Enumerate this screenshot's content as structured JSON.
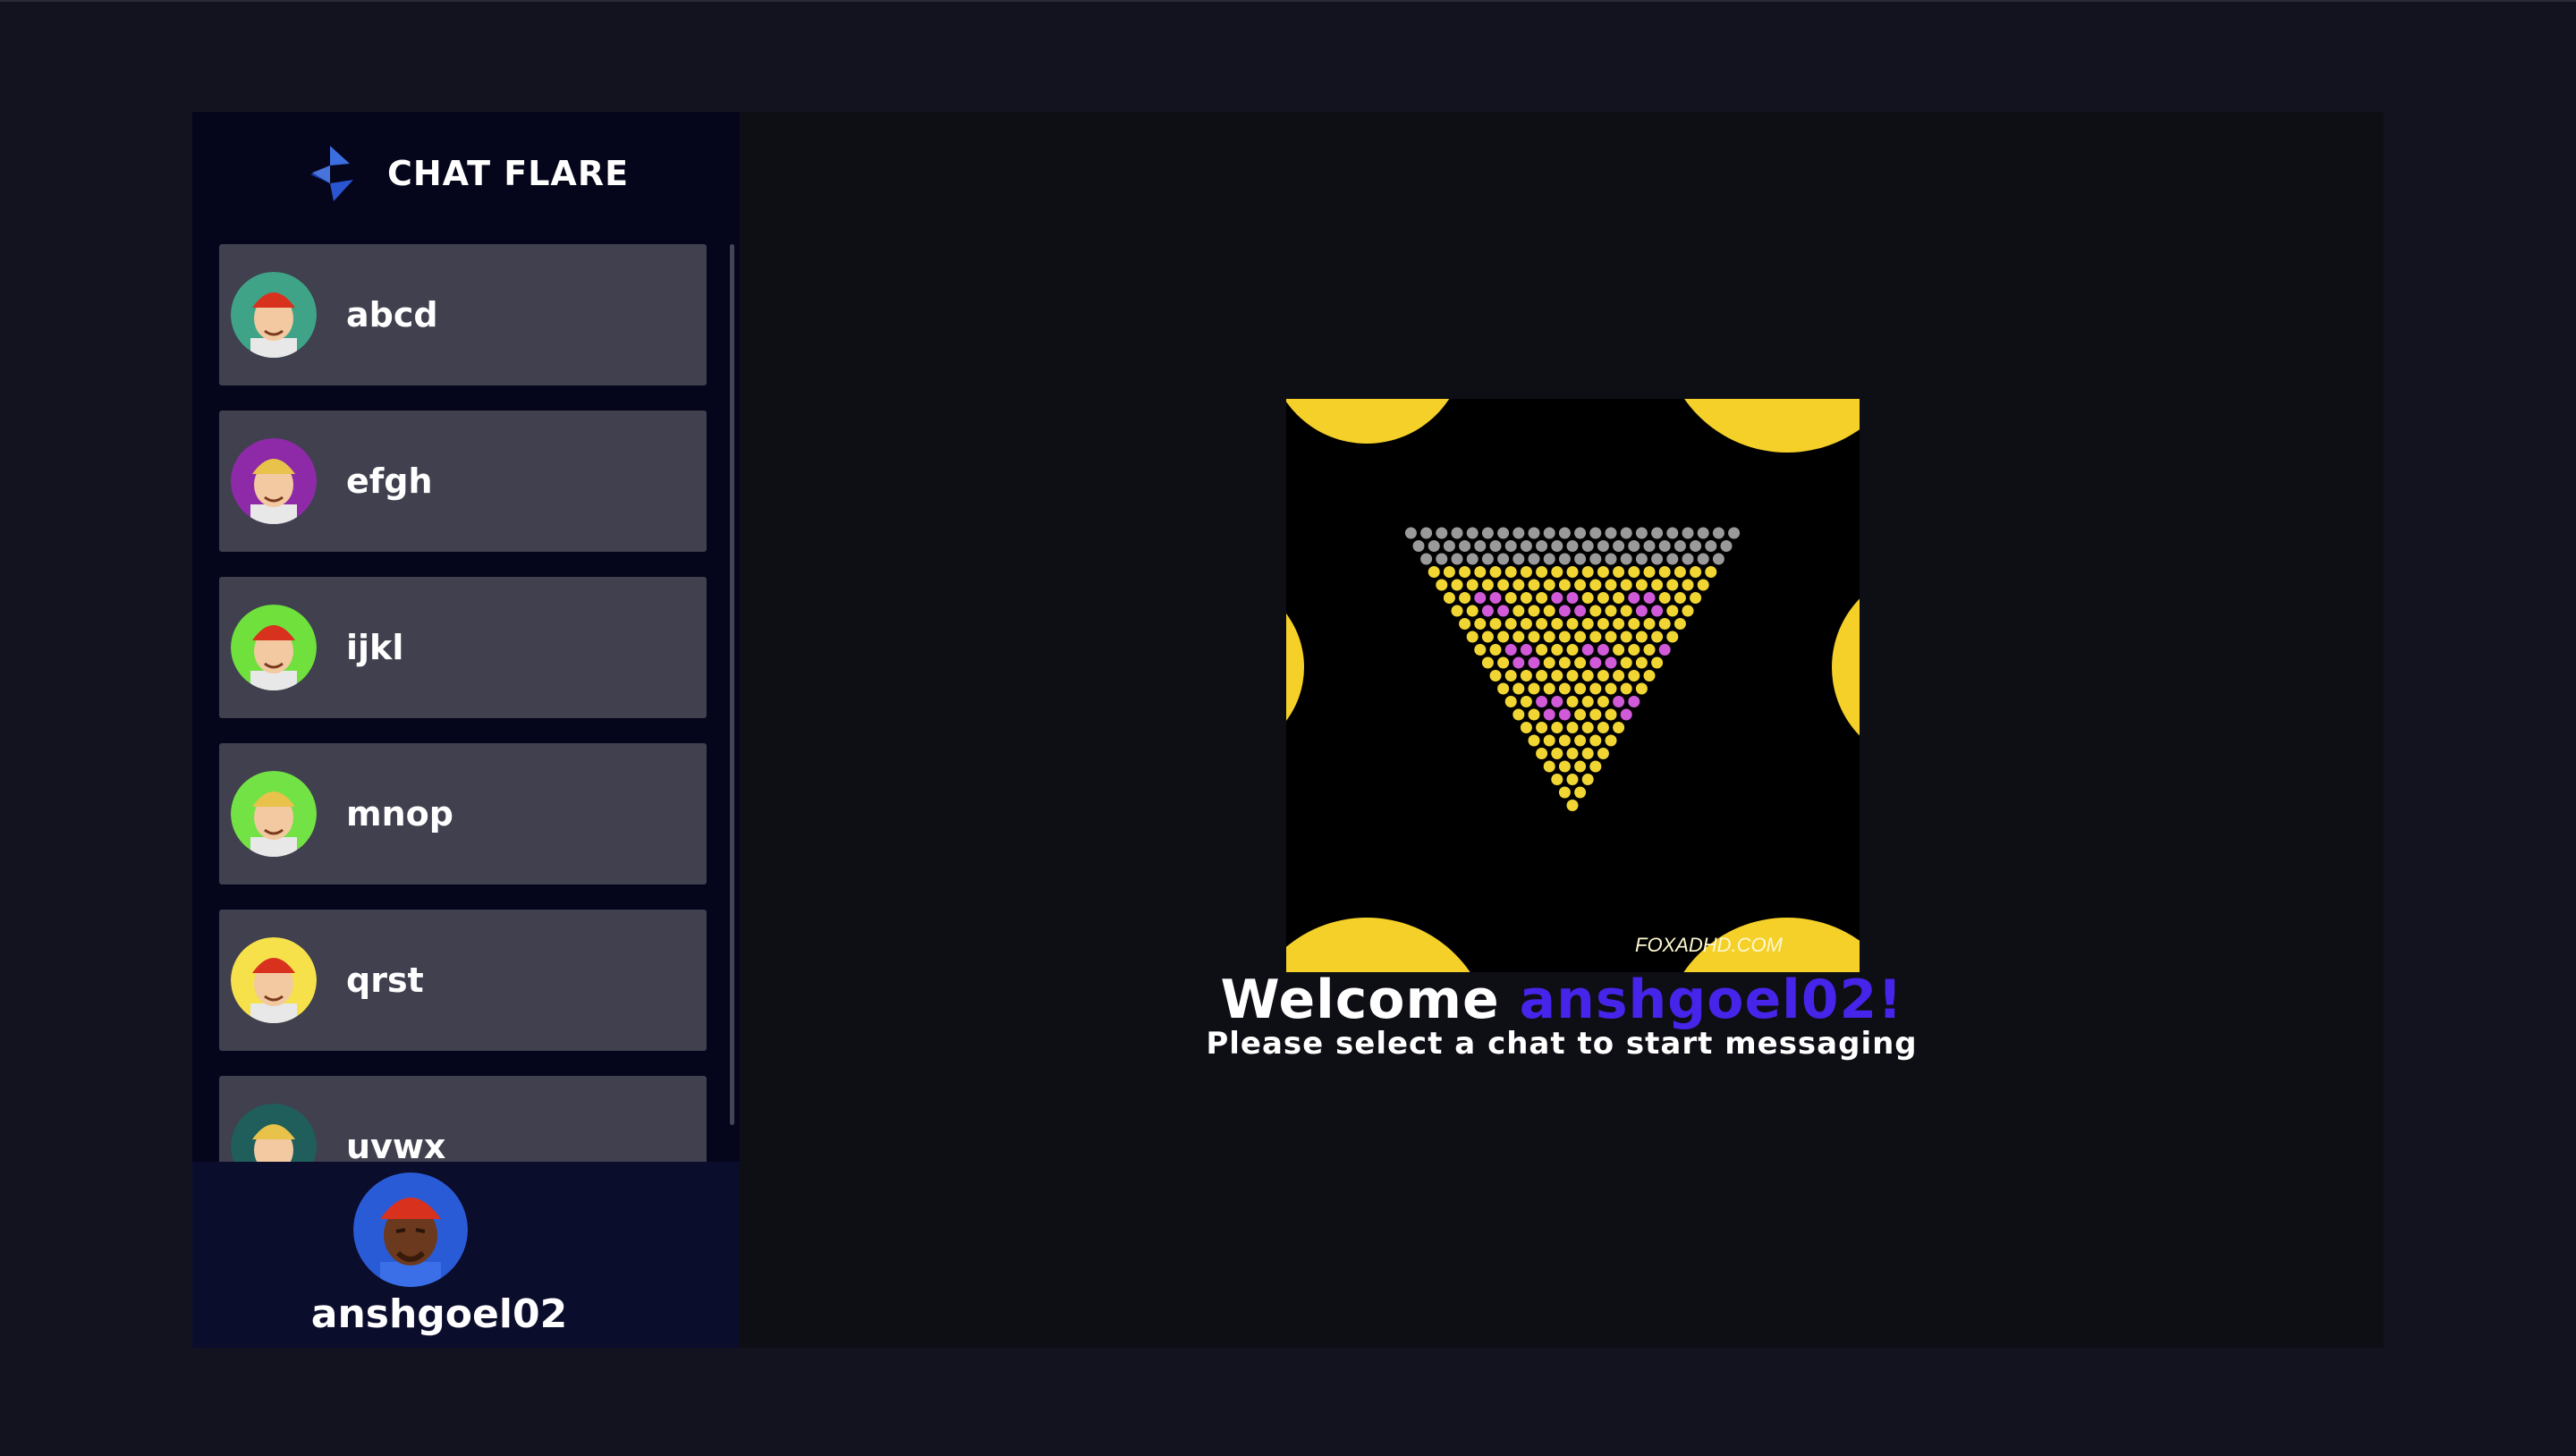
{
  "app": {
    "brand_name": "CHAT FLARE",
    "logo_icon": "diamond-flare-icon"
  },
  "chats": [
    {
      "name": "abcd",
      "avatar_icon": "avatar-red-hair-sunglasses-icon",
      "bg": "#3fa487"
    },
    {
      "name": "efgh",
      "avatar_icon": "avatar-dreadlocks-icon",
      "bg": "#8e2aa8"
    },
    {
      "name": "ijkl",
      "avatar_icon": "avatar-red-hair-beard-icon",
      "bg": "#6fe03c"
    },
    {
      "name": "mnop",
      "avatar_icon": "avatar-beanie-icon",
      "bg": "#73e244"
    },
    {
      "name": "qrst",
      "avatar_icon": "avatar-blonde-mask-icon",
      "bg": "#f6e14b"
    },
    {
      "name": "uvwx",
      "avatar_icon": "avatar-blonde-icon",
      "bg": "#1f5e5a"
    }
  ],
  "current_user": {
    "name": "anshgoel02",
    "avatar_icon": "avatar-red-hat-icon"
  },
  "welcome": {
    "greeting": "Welcome",
    "username": "anshgoel02!",
    "subtitle": "Please select a chat to start messaging",
    "hero_image_icon": "emoji-pyramid-gif",
    "watermark": "FOXADHD.COM"
  },
  "colors": {
    "accent": "#4624e9",
    "sidebar": "#05051b",
    "chat_item": "#40404f",
    "main_bg": "#0e0e15"
  }
}
